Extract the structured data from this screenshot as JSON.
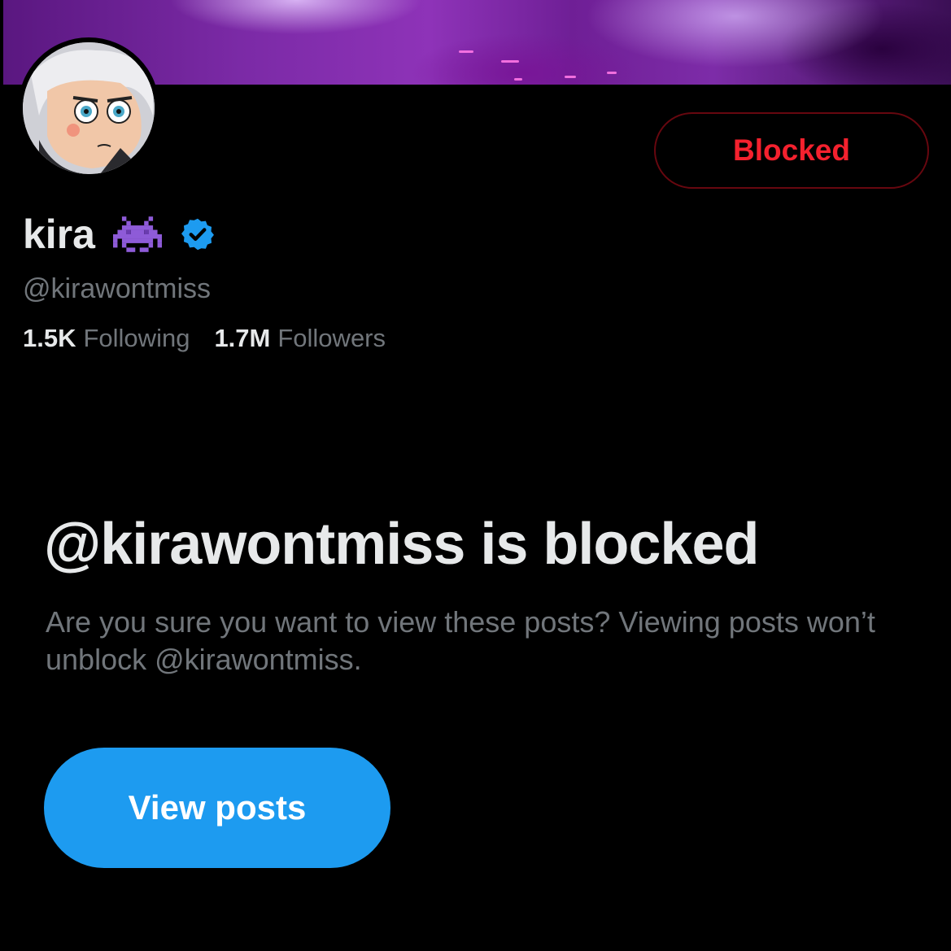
{
  "profile": {
    "display_name": "kira",
    "emoji_icon": "alien-monster-icon",
    "verified_icon": "verified-badge-icon",
    "handle": "@kirawontmiss",
    "following_count": "1.5K",
    "following_label": "Following",
    "followers_count": "1.7M",
    "followers_label": "Followers"
  },
  "actions": {
    "blocked_label": "Blocked",
    "view_posts_label": "View posts"
  },
  "notice": {
    "title": "@kirawontmiss is blocked",
    "description": "Are you sure you want to view these posts? Viewing posts won’t unblock @kirawontmiss."
  },
  "colors": {
    "background": "#000000",
    "blocked_red": "#f4212e",
    "accent_blue": "#1d9bf0",
    "secondary_text": "#71767b"
  }
}
